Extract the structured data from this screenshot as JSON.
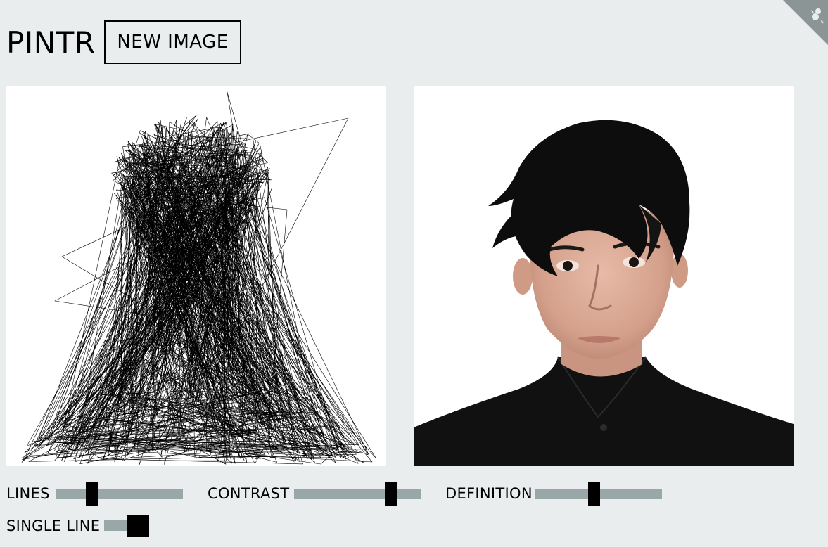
{
  "app": {
    "title": "PINTR",
    "new_image_label": "NEW IMAGE"
  },
  "ribbon": {
    "icon": "github-cat-icon",
    "color": "#8c9595"
  },
  "controls": {
    "lines": {
      "label": "LINES",
      "value": 0.26
    },
    "contrast": {
      "label": "CONTRAST",
      "value": 0.79
    },
    "definition": {
      "label": "DEFINITION",
      "value": 0.46
    },
    "single_line": {
      "label": "SINGLE LINE",
      "on": true
    }
  },
  "colors": {
    "background": "#e9edee",
    "track": "#9aa7a8",
    "ink": "#000000"
  }
}
